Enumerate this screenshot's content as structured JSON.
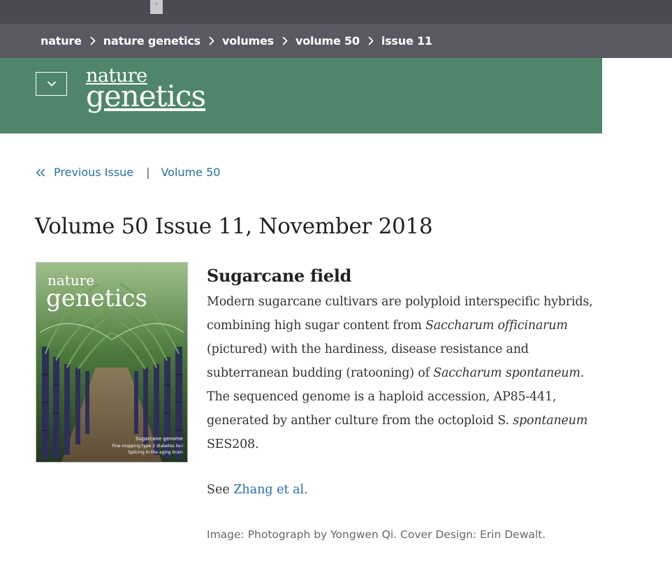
{
  "topbar": {
    "tab_glyph": "’"
  },
  "breadcrumb": {
    "items": [
      "nature",
      "nature genetics",
      "volumes",
      "volume 50",
      "issue 11"
    ]
  },
  "header": {
    "logo_line1": "nature",
    "logo_line2": "genetics",
    "menu_icon": "chevron-down-icon",
    "background_color": "#4f8669"
  },
  "issue_nav": {
    "previous_label": "Previous Issue",
    "separator": "|",
    "volume_label": "Volume 50"
  },
  "issue_title": "Volume 50 Issue 11, November 2018",
  "cover": {
    "masthead_line1": "nature",
    "masthead_line2": "genetics",
    "caption_line1": "Sugarcane genome",
    "caption_line2": "Fine-mapping type 2 diabetes loci",
    "caption_line3": "Splicing in the aging brain"
  },
  "article": {
    "heading": "Sugarcane field",
    "body_1": "Modern sugarcane cultivars are polyploid interspecific hybrids, combining high sugar content from ",
    "body_2_em": "Saccharum officinarum",
    "body_3": " (pictured) with the hardiness, disease resistance and subterranean budding (ratooning) of ",
    "body_4_em": "Saccharum spontaneum",
    "body_5": ". The sequenced genome is a haploid accession, AP85-441, generated by anther culture from the octoploid S. ",
    "body_6_em": "spontaneum",
    "body_7": " SES208.",
    "see_prefix": "See ",
    "see_link": "Zhang et al.",
    "credit": "Image: Photograph by Yongwen Qi. Cover Design: Erin Dewalt."
  },
  "colors": {
    "link": "#2a6ea6",
    "breadcrumb_bar": "#5a5963",
    "top_bar": "#4a4a55"
  }
}
